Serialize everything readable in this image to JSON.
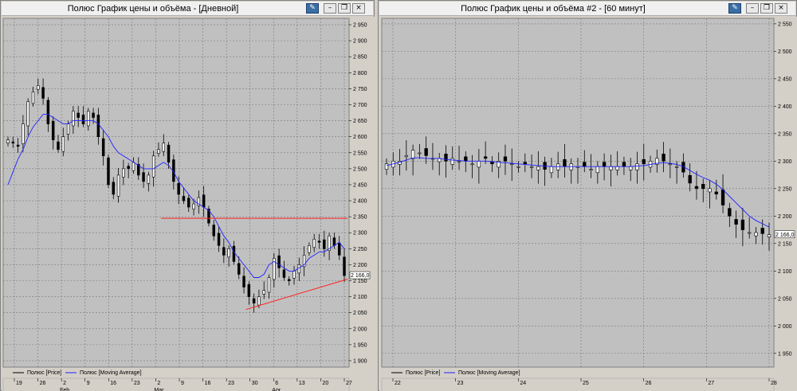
{
  "windows": [
    {
      "title": "Полюс График цены и объёма - [Дневной]",
      "last_price_label": "2 166,0",
      "y_ticks": [
        "2 950",
        "2 900",
        "2 850",
        "2 800",
        "2 750",
        "2 700",
        "2 650",
        "2 600",
        "2 550",
        "2 500",
        "2 450",
        "2 400",
        "2 350",
        "2 300",
        "2 250",
        "2 200",
        "2 150",
        "2 100",
        "2 050",
        "2 000",
        "1 950",
        "1 900"
      ],
      "x_days": [
        "19",
        "26",
        "2",
        "9",
        "16",
        "23",
        "2",
        "9",
        "16",
        "23",
        "30",
        "6",
        "13",
        "20",
        "27"
      ],
      "x_months": [
        "Feb",
        "Mar",
        "Apr"
      ],
      "legend": [
        "Полюс [Price]",
        "Полюс [Moving Average]"
      ]
    },
    {
      "title": "Полюс График цены и объёма #2 - [60 минут]",
      "last_price_label": "2 166,0",
      "y_ticks": [
        "2 550",
        "2 500",
        "2 450",
        "2 400",
        "2 350",
        "2 300",
        "2 250",
        "2 200",
        "2 150",
        "2 100",
        "2 050",
        "2 000",
        "1 950"
      ],
      "x_days": [
        "22",
        "23",
        "24",
        "25",
        "26",
        "27",
        "28"
      ],
      "legend": [
        "Полюс [Price]",
        "Полюс [Moving Average]"
      ]
    }
  ],
  "colors": {
    "chart_bg": "#c0c0c0",
    "grid": "#7a7a7a",
    "ma_line": "#2020ff",
    "trend_line": "#ff2020",
    "candle": "#000000",
    "frame": "#d4d0c8"
  },
  "icons": [
    "pin-icon",
    "minimize-icon",
    "restore-icon",
    "close-icon"
  ],
  "chart_data": [
    {
      "type": "candlestick",
      "title": "Полюс График цены и объёма - [Дневной]",
      "ylim": [
        1880,
        2970
      ],
      "series": [
        {
          "name": "Полюс [Price]",
          "close": [
            2590,
            2580,
            2570,
            2640,
            2710,
            2740,
            2760,
            2720,
            2640,
            2590,
            2560,
            2600,
            2640,
            2680,
            2660,
            2640,
            2680,
            2660,
            2600,
            2540,
            2450,
            2420,
            2480,
            2500,
            2500,
            2520,
            2480,
            2460,
            2480,
            2540,
            2560,
            2580,
            2520,
            2460,
            2420,
            2400,
            2380,
            2390,
            2410,
            2380,
            2330,
            2290,
            2260,
            2230,
            2250,
            2210,
            2170,
            2130,
            2100,
            2080,
            2100,
            2120,
            2160,
            2220,
            2190,
            2160,
            2150,
            2180,
            2200,
            2230,
            2260,
            2280,
            2270,
            2250,
            2290,
            2260,
            2230,
            2166
          ]
        },
        {
          "name": "Полюс [Moving Average]",
          "values": [
            2450,
            2490,
            2530,
            2560,
            2600,
            2630,
            2650,
            2670,
            2670,
            2660,
            2650,
            2640,
            2640,
            2650,
            2650,
            2650,
            2650,
            2650,
            2640,
            2620,
            2600,
            2570,
            2550,
            2540,
            2530,
            2520,
            2510,
            2500,
            2500,
            2500,
            2510,
            2520,
            2510,
            2490,
            2460,
            2440,
            2420,
            2400,
            2390,
            2380,
            2370,
            2350,
            2320,
            2290,
            2270,
            2240,
            2220,
            2200,
            2180,
            2160,
            2160,
            2170,
            2200,
            2210,
            2200,
            2190,
            2180,
            2180,
            2190,
            2200,
            2220,
            2230,
            2240,
            2240,
            2250,
            2260,
            2270,
            2250
          ]
        }
      ],
      "trend_lines": [
        {
          "from": [
            "Mar 9",
            2345
          ],
          "to": [
            "Apr 27",
            2345
          ]
        },
        {
          "from": [
            "Mar 30",
            2060
          ],
          "to": [
            "Apr 27",
            2155
          ]
        }
      ]
    },
    {
      "type": "candlestick",
      "title": "Полюс График цены и объёма #2 - [60 минут]",
      "ylim": [
        1925,
        2560
      ],
      "series": [
        {
          "name": "Полюс [Price]",
          "close": [
            2295,
            2300,
            2300,
            2310,
            2320,
            2315,
            2310,
            2305,
            2305,
            2300,
            2305,
            2300,
            2300,
            2295,
            2300,
            2305,
            2295,
            2300,
            2300,
            2295,
            2290,
            2295,
            2290,
            2290,
            2285,
            2290,
            2295,
            2290,
            2295,
            2290,
            2290,
            2285,
            2290,
            2290,
            2290,
            2290,
            2290,
            2290,
            2295,
            2295,
            2300,
            2305,
            2300,
            2295,
            2290,
            2280,
            2260,
            2250,
            2250,
            2250,
            2240,
            2220,
            2200,
            2185,
            2175,
            2170,
            2170,
            2168,
            2166
          ]
        },
        {
          "name": "Полюс [Moving Average]",
          "values": [
            2292,
            2295,
            2298,
            2302,
            2306,
            2306,
            2305,
            2305,
            2305,
            2303,
            2302,
            2301,
            2300,
            2300,
            2300,
            2300,
            2299,
            2298,
            2297,
            2296,
            2295,
            2294,
            2293,
            2292,
            2291,
            2290,
            2290,
            2290,
            2290,
            2290,
            2290,
            2290,
            2290,
            2290,
            2290,
            2290,
            2290,
            2290,
            2291,
            2292,
            2294,
            2296,
            2297,
            2296,
            2294,
            2290,
            2283,
            2276,
            2270,
            2265,
            2258,
            2248,
            2236,
            2224,
            2212,
            2200,
            2192,
            2186,
            2180
          ]
        }
      ]
    }
  ]
}
